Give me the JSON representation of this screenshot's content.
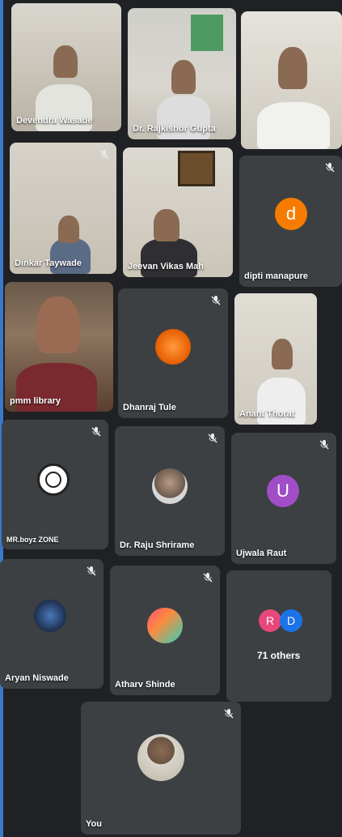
{
  "participants": [
    {
      "name": "Devendra Wasade"
    },
    {
      "name": "Dr. Rajkishor Gupta"
    },
    {
      "name": ""
    },
    {
      "name": "Dinkar Taywade"
    },
    {
      "name": "Jeevan Vikas Mah"
    },
    {
      "name": "dipti manapure",
      "initial": "d"
    },
    {
      "name": "pmm library"
    },
    {
      "name": "Dhanraj Tule"
    },
    {
      "name": "Anant Thorat"
    },
    {
      "name": "MR.boyz ZONE"
    },
    {
      "name": "Dr. Raju Shrirame"
    },
    {
      "name": "Ujwala Raut",
      "initial": "U"
    },
    {
      "name": "Aryan Niswade"
    },
    {
      "name": "Atharv Shinde"
    },
    {
      "name": "You"
    }
  ],
  "others": {
    "label": "71 others",
    "initials": [
      "R",
      "D"
    ]
  },
  "icons": {
    "mute": "mic-off-icon"
  },
  "colors": {
    "background": "#202124",
    "tile": "#3c4043",
    "avatar_d": "#f57c00",
    "avatar_u": "#a04dc7",
    "avatar_r": "#e8477b",
    "avatar_d2": "#1a73e8"
  }
}
